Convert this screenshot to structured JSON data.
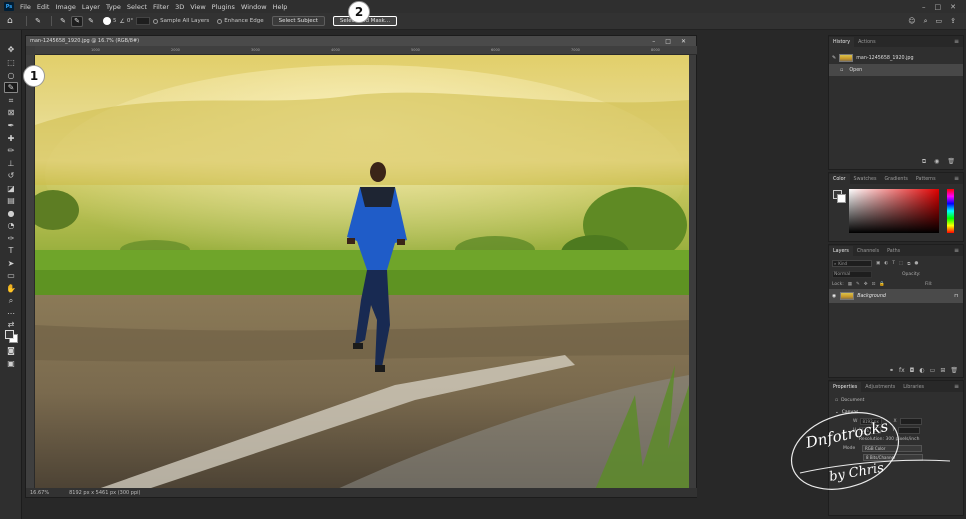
{
  "app": {
    "logo_text": "Ps"
  },
  "menu": [
    "File",
    "Edit",
    "Image",
    "Layer",
    "Type",
    "Select",
    "Filter",
    "3D",
    "View",
    "Plugins",
    "Window",
    "Help"
  ],
  "options_bar": {
    "brush_size": "5",
    "angle": "0°",
    "sample_all_layers": "Sample All Layers",
    "enhance_edge": "Enhance Edge",
    "select_subject": "Select Subject",
    "select_and_mask": "Select and Mask..."
  },
  "callouts": {
    "one": "1",
    "two": "2"
  },
  "document": {
    "title": "man-1245658_1920.jpg @ 16.7% (RGB/8#)",
    "zoom": "16.67%",
    "dimensions": "8192 px x 5461 px (300 ppi)",
    "ruler_ticks": [
      "1000",
      "2000",
      "3000",
      "4000",
      "5000",
      "6000",
      "7000",
      "8000"
    ]
  },
  "history": {
    "tabs": [
      "History",
      "Actions"
    ],
    "items": [
      {
        "label": "man-1245658_1920.jpg"
      },
      {
        "label": "Open"
      }
    ]
  },
  "color_panel": {
    "tabs": [
      "Color",
      "Swatches",
      "Gradients",
      "Patterns"
    ]
  },
  "layers": {
    "tabs": [
      "Layers",
      "Channels",
      "Paths"
    ],
    "filter_label": "Kind",
    "blend_mode": "Normal",
    "opacity_label": "Opacity:",
    "lock_label": "Lock:",
    "fill_label": "Fill:",
    "layer_name": "Background"
  },
  "properties": {
    "tabs": [
      "Properties",
      "Adjustments",
      "Libraries"
    ],
    "doc_label": "Document",
    "canvas_section": "Canvas",
    "w_label": "W",
    "w_value": "8192 px",
    "h_label": "H",
    "h_value": "5461 px",
    "x_label": "X",
    "y_label": "Y",
    "res_text": "Resolution: 300 pixels/inch",
    "mode_label": "Mode",
    "mode_value": "RGB Color",
    "depth_value": "8 Bits/Channel"
  },
  "watermark": {
    "line1": "Dnfotrocks",
    "line2": "by Chris"
  },
  "colors": {
    "accent": "#31a8ff",
    "ui_bg": "#282828",
    "panel_bg": "#2f2f2f"
  }
}
